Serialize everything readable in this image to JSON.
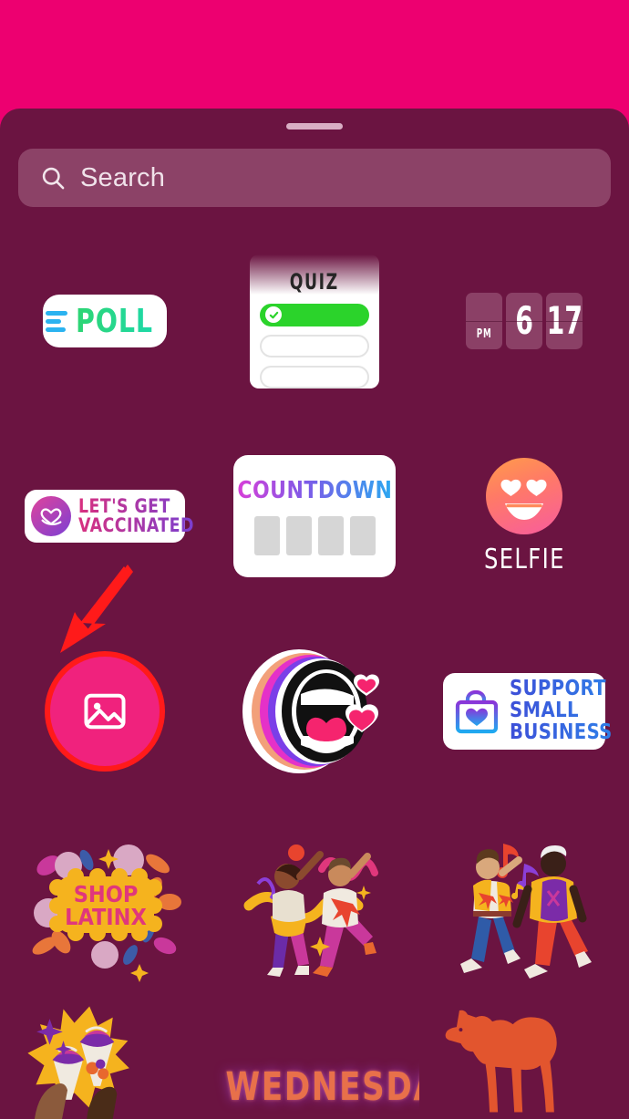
{
  "app": {
    "name": "Instagram Story Sticker Tray",
    "top_band_color": "#ED0070",
    "tray_color": "#6B1441",
    "accent_color": "#F0227D",
    "annotation_color": "#FF1A1A"
  },
  "tray": {
    "drag_handle": "drag-handle"
  },
  "search": {
    "placeholder": "Search",
    "icon": "search-icon"
  },
  "stickers": {
    "poll": {
      "label": "POLL",
      "icon": "poll-bars-icon",
      "bar_color": "#2BB3F0",
      "text_gradient": [
        "#2ED573",
        "#1ED9A8"
      ]
    },
    "quiz": {
      "title": "QUIZ",
      "options": [
        "correct",
        "empty",
        "empty"
      ],
      "correct_color": "#2BD32B",
      "check_icon": "check-icon"
    },
    "time": {
      "meridiem": "PM",
      "hour": "6",
      "minute": "17"
    },
    "vaccinated": {
      "line1": "LET'S GET",
      "line2": "VACCINATED",
      "icon": "heart-ribbon-icon",
      "badge_gradient": [
        "#E0449B",
        "#7B3FD4"
      ]
    },
    "countdown": {
      "title": "COUNTDOWN",
      "block_count": 4,
      "block_color": "#D6D6D6",
      "text_gradient": [
        "#D73FD8",
        "#7B5BE8",
        "#2BA8F0"
      ]
    },
    "selfie": {
      "label": "SELFIE",
      "icon": "heart-eyes-face-icon",
      "face_gradient": [
        "#FF9C4A",
        "#FF7A66",
        "#F85C9E"
      ]
    },
    "photo": {
      "icon": "photo-image-icon",
      "circle_color": "#F0227D",
      "highlighted": true
    },
    "mouth": {
      "icon": "open-mouth-icon",
      "hearts": 2
    },
    "support_small_business": {
      "line1": "SUPPORT",
      "line2": "SMALL",
      "line3": "BUSINESS",
      "icon": "shopping-bag-heart-icon",
      "text_gradient": [
        "#3D4FD8",
        "#2F7FE8"
      ]
    },
    "shop_latinx": {
      "line1": "SHOP",
      "line2": "LATINX",
      "icon": "floral-badge-icon",
      "badge_color": "#F5B31E",
      "text_color": "#E0377C"
    },
    "dancers_a": {
      "icon": "dancing-couple-icon"
    },
    "dancers_b": {
      "icon": "dancing-men-music-icon"
    },
    "ice_cream": {
      "icon": "ice-cream-cones-icon"
    },
    "wednesday": {
      "label": "WEDNESDAY"
    },
    "camel": {
      "icon": "camel-icon",
      "color": "#E2552E"
    }
  },
  "annotation": {
    "arrow": "red-arrow-pointing-to-photo-sticker"
  }
}
